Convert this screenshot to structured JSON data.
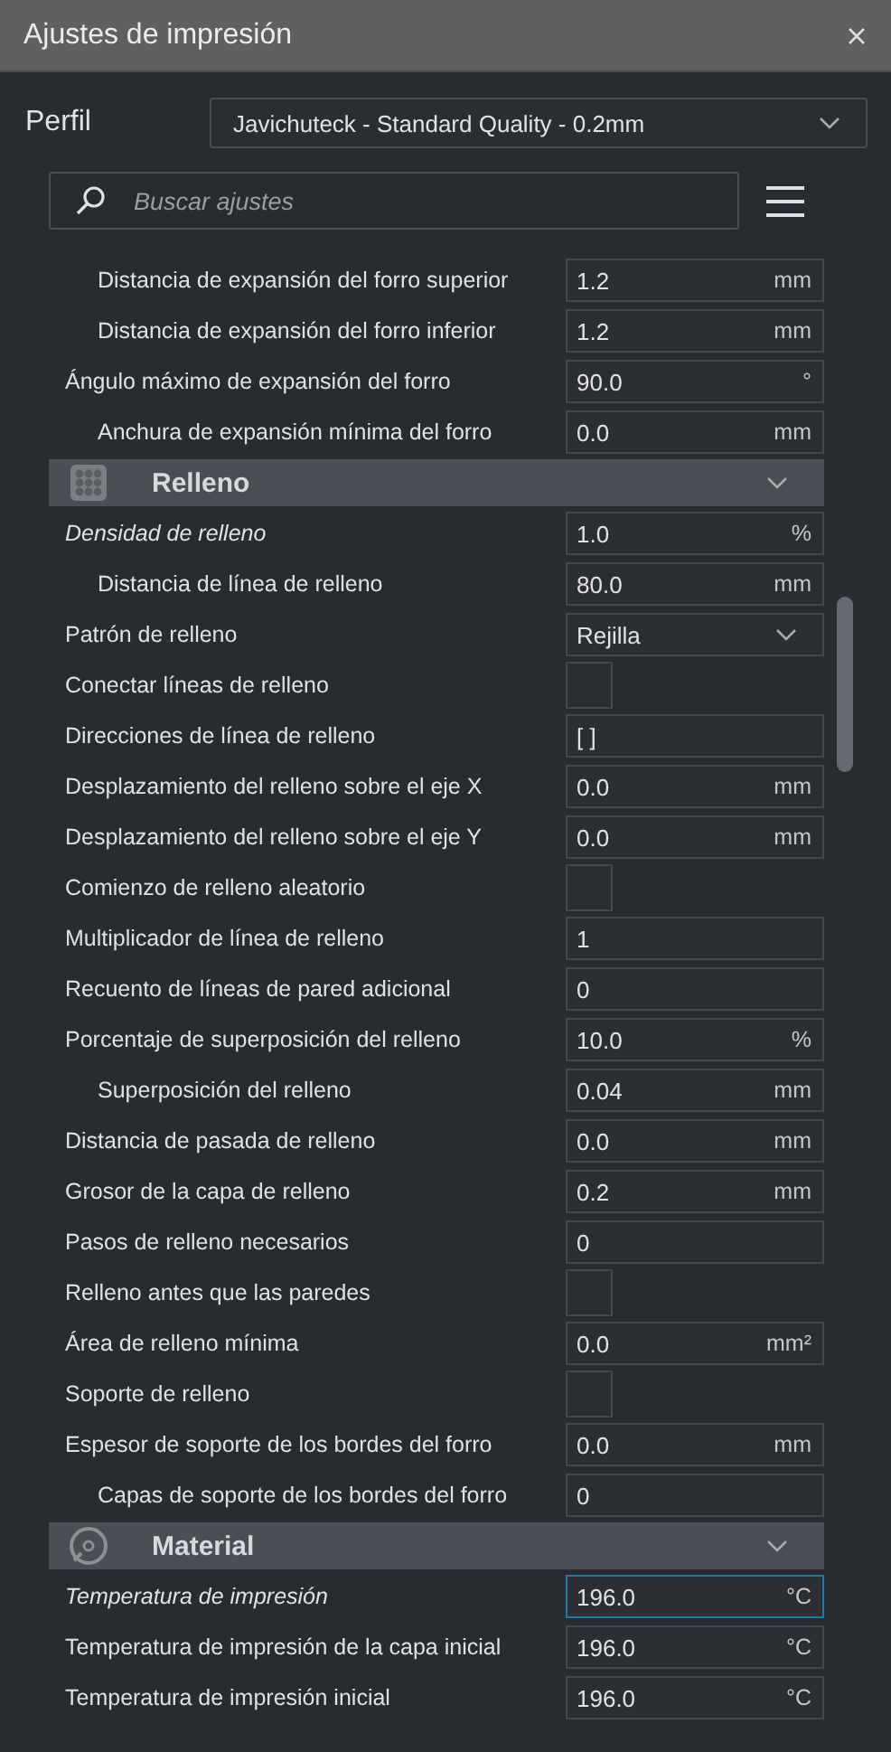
{
  "window": {
    "title": "Ajustes de impresión"
  },
  "profile": {
    "label": "Perfil",
    "value": "Javichuteck - Standard Quality - 0.2mm"
  },
  "search": {
    "placeholder": "Buscar ajustes"
  },
  "settings": [
    {
      "children": [
        {
          "label": "Distancia de expansión del forro superior",
          "kind": "number",
          "value": "1.2",
          "unit": "mm",
          "modified": false,
          "focused": false
        },
        {
          "label": "Distancia de expansión del forro inferior",
          "kind": "number",
          "value": "1.2",
          "unit": "mm",
          "modified": false,
          "focused": false
        }
      ]
    },
    {
      "label": "Ángulo máximo de expansión del forro",
      "kind": "number",
      "value": "90.0",
      "unit": "°",
      "modified": false,
      "focused": false,
      "children": [
        {
          "label": "Anchura de expansión mínima del forro",
          "kind": "number",
          "value": "0.0",
          "unit": "mm",
          "modified": false,
          "focused": false
        }
      ]
    },
    {
      "kind": "section",
      "title": "Relleno",
      "expanded": true
    },
    {
      "label": "Densidad de relleno",
      "kind": "number",
      "value": "1.0",
      "unit": "%",
      "modified": true,
      "focused": false,
      "children": [
        {
          "label": "Distancia de línea de relleno",
          "kind": "number",
          "value": "80.0",
          "unit": "mm",
          "modified": false,
          "focused": false
        }
      ]
    },
    {
      "label": "Patrón de relleno",
      "kind": "dropdown",
      "value": "Rejilla",
      "modified": false
    },
    {
      "label": "Conectar líneas de relleno",
      "kind": "checkbox",
      "checked": false,
      "modified": false
    },
    {
      "label": "Direcciones de línea de relleno",
      "kind": "number",
      "value": "[ ]",
      "modified": false,
      "focused": false
    },
    {
      "label": "Desplazamiento del relleno sobre el eje X",
      "kind": "number",
      "value": "0.0",
      "unit": "mm",
      "modified": false,
      "focused": false
    },
    {
      "label": "Desplazamiento del relleno sobre el eje Y",
      "kind": "number",
      "value": "0.0",
      "unit": "mm",
      "modified": false,
      "focused": false
    },
    {
      "label": "Comienzo de relleno aleatorio",
      "kind": "checkbox",
      "checked": false,
      "modified": false
    },
    {
      "label": "Multiplicador de línea de relleno",
      "kind": "number",
      "value": "1",
      "modified": false,
      "focused": false
    },
    {
      "label": "Recuento de líneas de pared adicional",
      "kind": "number",
      "value": "0",
      "modified": false,
      "focused": false
    },
    {
      "label": "Porcentaje de superposición del relleno",
      "kind": "number",
      "value": "10.0",
      "unit": "%",
      "modified": false,
      "focused": false,
      "children": [
        {
          "label": "Superposición del relleno",
          "kind": "number",
          "value": "0.04",
          "unit": "mm",
          "modified": false,
          "focused": false
        }
      ]
    },
    {
      "label": "Distancia de pasada de relleno",
      "kind": "number",
      "value": "0.0",
      "unit": "mm",
      "modified": false,
      "focused": false
    },
    {
      "label": "Grosor de la capa de relleno",
      "kind": "number",
      "value": "0.2",
      "unit": "mm",
      "modified": false,
      "focused": false
    },
    {
      "label": "Pasos de relleno necesarios",
      "kind": "number",
      "value": "0",
      "modified": false,
      "focused": false
    },
    {
      "label": "Relleno antes que las paredes",
      "kind": "checkbox",
      "checked": false,
      "modified": false
    },
    {
      "label": "Área de relleno mínima",
      "kind": "number",
      "value": "0.0",
      "unit": "mm²",
      "modified": false,
      "focused": false
    },
    {
      "label": "Soporte de relleno",
      "kind": "checkbox",
      "checked": false,
      "modified": false
    },
    {
      "label": "Espesor de soporte de los bordes del forro",
      "kind": "number",
      "value": "0.0",
      "unit": "mm",
      "modified": false,
      "focused": false,
      "children": [
        {
          "label": "Capas de soporte de los bordes del forro",
          "kind": "number",
          "value": "0",
          "modified": false,
          "focused": false
        }
      ]
    },
    {
      "kind": "section",
      "title": "Material",
      "expanded": true
    },
    {
      "label": "Temperatura de impresión",
      "kind": "number",
      "value": "196.0",
      "unit": "°C",
      "modified": true,
      "focused": true
    },
    {
      "label": "Temperatura de impresión de la capa inicial",
      "kind": "number",
      "value": "196.0",
      "unit": "°C",
      "modified": false,
      "focused": false
    },
    {
      "label": "Temperatura de impresión inicial",
      "kind": "number",
      "value": "196.0",
      "unit": "°C",
      "modified": false,
      "focused": false
    }
  ]
}
